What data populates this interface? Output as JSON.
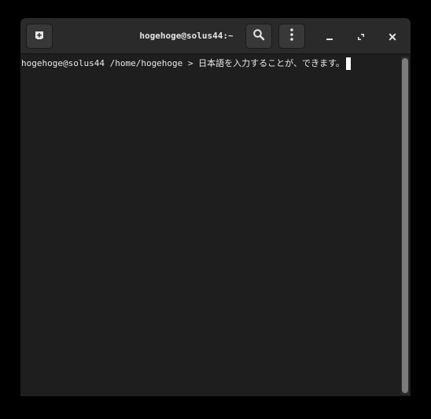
{
  "window": {
    "title": "hogehoge@solus44:~"
  },
  "headerbar": {
    "new_tab_icon": "new-tab-icon",
    "search_icon": "search-icon",
    "menu_icon": "vertical-dots-icon",
    "minimize_icon": "minimize-icon",
    "maximize_icon": "maximize-icon",
    "close_icon": "close-icon"
  },
  "terminal": {
    "prompt": "hogehoge@solus44 /home/hogehoge > ",
    "input": "日本語を入力することが、できます。"
  },
  "colors": {
    "background": "#1e1e1e",
    "headerbar": "#2a2a2a",
    "text": "#e8e8e8",
    "cursor": "#ffffff"
  }
}
